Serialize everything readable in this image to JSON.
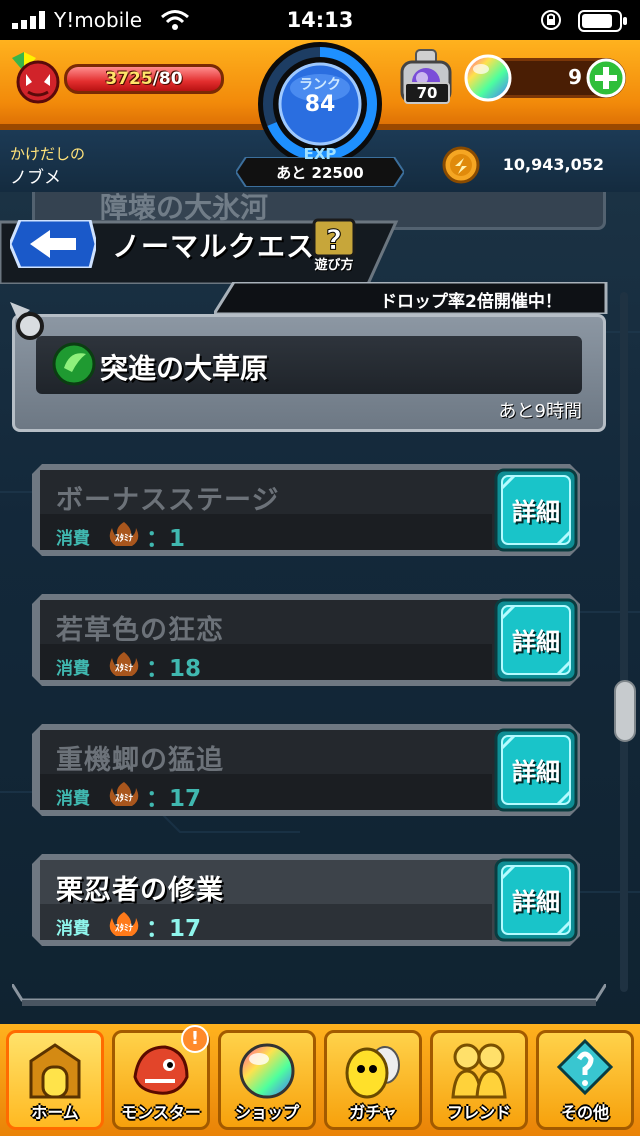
{
  "status_bar": {
    "carrier": "Y!mobile",
    "time": "14:13"
  },
  "player": {
    "stamina_current": "3725",
    "stamina_max": "/80",
    "stamina_fill": 1.0,
    "rank_label": "ランク",
    "rank": "84",
    "exp_label": "EXP",
    "exp_remaining": "あと 22500",
    "nickname_label": "かけだしの",
    "nickname": "ノブメ",
    "gold": "10,943,052",
    "orbs": "9",
    "stamp_item_count": "70"
  },
  "header": {
    "title": "ノーマルクエスト",
    "help_label": "遊び方",
    "ghost_title": "障壊の大氷河"
  },
  "area": {
    "drop_banner": "ドロップ率2倍開催中！",
    "name": "突進の大草原",
    "remaining": "あと9時間"
  },
  "stages": [
    {
      "name": "ボーナスステージ",
      "cost_label": "消費",
      "stamina_label": "ｽﾀﾐﾅ",
      "cost": "：1",
      "active": false,
      "detail_label": "詳細"
    },
    {
      "name": "若草色の狂恋",
      "cost_label": "消費",
      "stamina_label": "ｽﾀﾐﾅ",
      "cost": "：18",
      "active": false,
      "detail_label": "詳細"
    },
    {
      "name": "重機蝍の猛追",
      "cost_label": "消費",
      "stamina_label": "ｽﾀﾐﾅ",
      "cost": "：17",
      "active": false,
      "detail_label": "詳細"
    },
    {
      "name": "栗忍者の修業",
      "cost_label": "消費",
      "stamina_label": "ｽﾀﾐﾅ",
      "cost": "：17",
      "active": true,
      "detail_label": "詳細"
    }
  ],
  "nav": [
    {
      "label": "ホーム",
      "icon": "home-gate-icon",
      "active": true
    },
    {
      "label": "モンスター",
      "icon": "monster-icon",
      "active": false,
      "badge": "!"
    },
    {
      "label": "ショップ",
      "icon": "rainbow-orb-icon",
      "active": false
    },
    {
      "label": "ガチャ",
      "icon": "gacha-egg-icon",
      "active": false
    },
    {
      "label": "フレンド",
      "icon": "friends-icon",
      "active": false
    },
    {
      "label": "その他",
      "icon": "other-menu-icon",
      "active": false
    }
  ],
  "colors": {
    "hud_orange": "#f28a0a",
    "detail_cyan": "#19c4c9",
    "cost_teal": "#40b8b0",
    "stamina_red": "#e32e2e"
  }
}
